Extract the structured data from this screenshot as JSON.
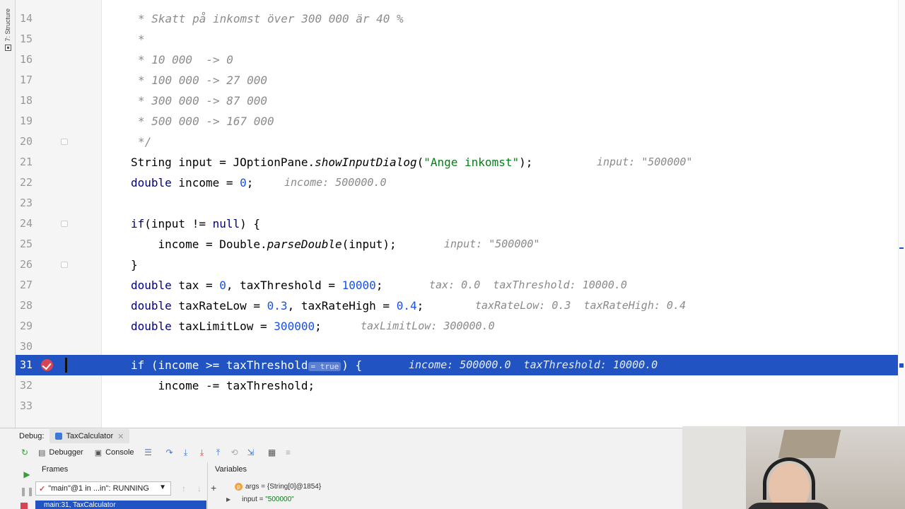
{
  "sidebar": {
    "structure_label": "7: Structure"
  },
  "editor": {
    "lines": [
      {
        "n": "14",
        "text": "* Skatt på inkomst över 300 000 är 40 %"
      },
      {
        "n": "15",
        "text": "*"
      },
      {
        "n": "16",
        "text": "* 10 000  -> 0"
      },
      {
        "n": "17",
        "text": "* 100 000 -> 27 000"
      },
      {
        "n": "18",
        "text": "* 300 000 -> 87 000"
      },
      {
        "n": "19",
        "text": "* 500 000 -> 167 000"
      },
      {
        "n": "20",
        "text": "*/"
      },
      {
        "n": "21",
        "hint": "input: \"500000\""
      },
      {
        "n": "22",
        "hint": "income: 500000.0"
      },
      {
        "n": "23"
      },
      {
        "n": "24"
      },
      {
        "n": "25",
        "hint": "input: \"500000\""
      },
      {
        "n": "26"
      },
      {
        "n": "27",
        "hint": "tax: 0.0  taxThreshold: 10000.0"
      },
      {
        "n": "28",
        "hint": "taxRateLow: 0.3  taxRateHigh: 0.4"
      },
      {
        "n": "29",
        "hint": "taxLimitLow: 300000.0"
      },
      {
        "n": "30"
      },
      {
        "n": "31",
        "inline_value": "= true",
        "hint": "income: 500000.0  taxThreshold: 10000.0"
      },
      {
        "n": "32"
      },
      {
        "n": "33"
      }
    ]
  },
  "debug": {
    "title": "Debug:",
    "run_config": "TaxCalculator",
    "tab_debugger": "Debugger",
    "tab_console": "Console",
    "frames_title": "Frames",
    "variables_title": "Variables",
    "thread": "\"main\"@1 in ...in\": RUNNING",
    "frame": "main:31, TaxCalculator",
    "vars": [
      {
        "name": "args",
        "value": "{String[0]@1854}"
      },
      {
        "name": "input",
        "value": "\"500000\""
      }
    ]
  },
  "colors": {
    "execution_line": "#2154c2",
    "breakpoint": "#d94452",
    "keyword": "#000080",
    "number": "#1750eb",
    "string": "#067d17",
    "comment": "#8c8c8c"
  }
}
